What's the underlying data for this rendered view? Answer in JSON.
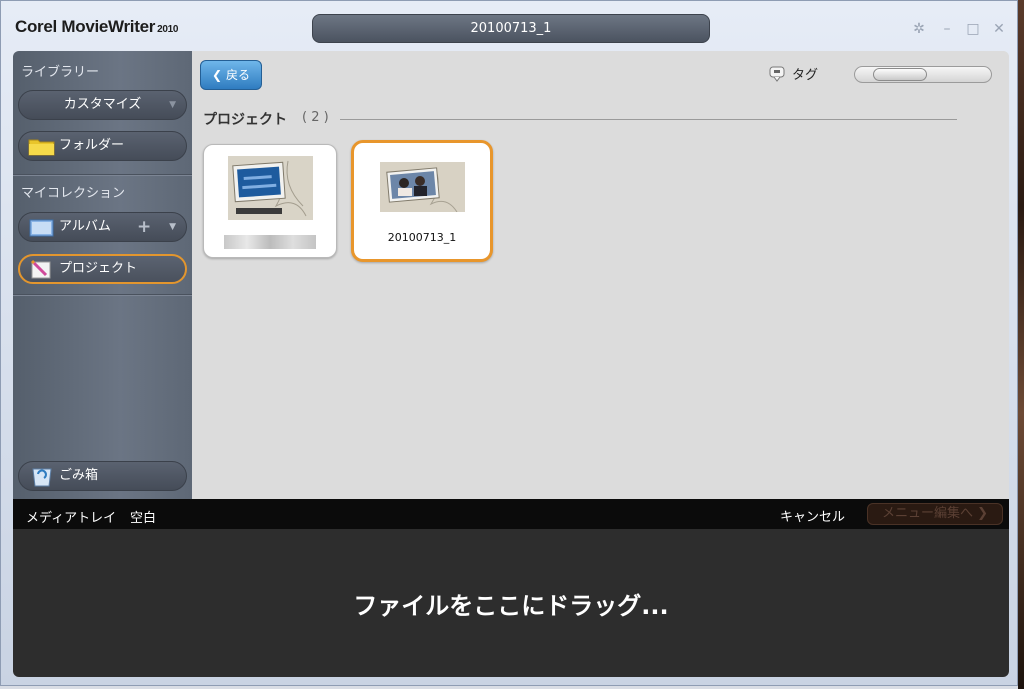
{
  "app": {
    "name": "Corel MovieWriter",
    "version": "2010"
  },
  "project_title": "20100713_1",
  "window_controls": {
    "settings_glyph": "✲",
    "minimize_glyph": "–",
    "maximize_glyph": "□",
    "close_glyph": "✕"
  },
  "sidebar": {
    "library_heading": "ライブラリー",
    "customize_label": "カスタマイズ",
    "folder_label": "フォルダー",
    "collection_heading": "マイコレクション",
    "album_label": "アルバム",
    "project_label": "プロジェクト",
    "trash_label": "ごみ箱"
  },
  "toolbar": {
    "back_label": "戻る",
    "tag_label": "タグ"
  },
  "projects": {
    "section_title": "プロジェクト",
    "count": "( 2 )",
    "items": [
      {
        "label": "",
        "selected": false
      },
      {
        "label": "20100713_1",
        "selected": true
      }
    ]
  },
  "tray": {
    "title": "メディアトレイ",
    "status": "空白",
    "cancel_label": "キャンセル",
    "menu_edit_label": "メニュー編集へ ❯",
    "drop_hint": "ファイルをここにドラッグ..."
  },
  "colors": {
    "accent": "#e8962c",
    "back_button": "#3a8ad0",
    "tray": "#2d2d2d"
  }
}
